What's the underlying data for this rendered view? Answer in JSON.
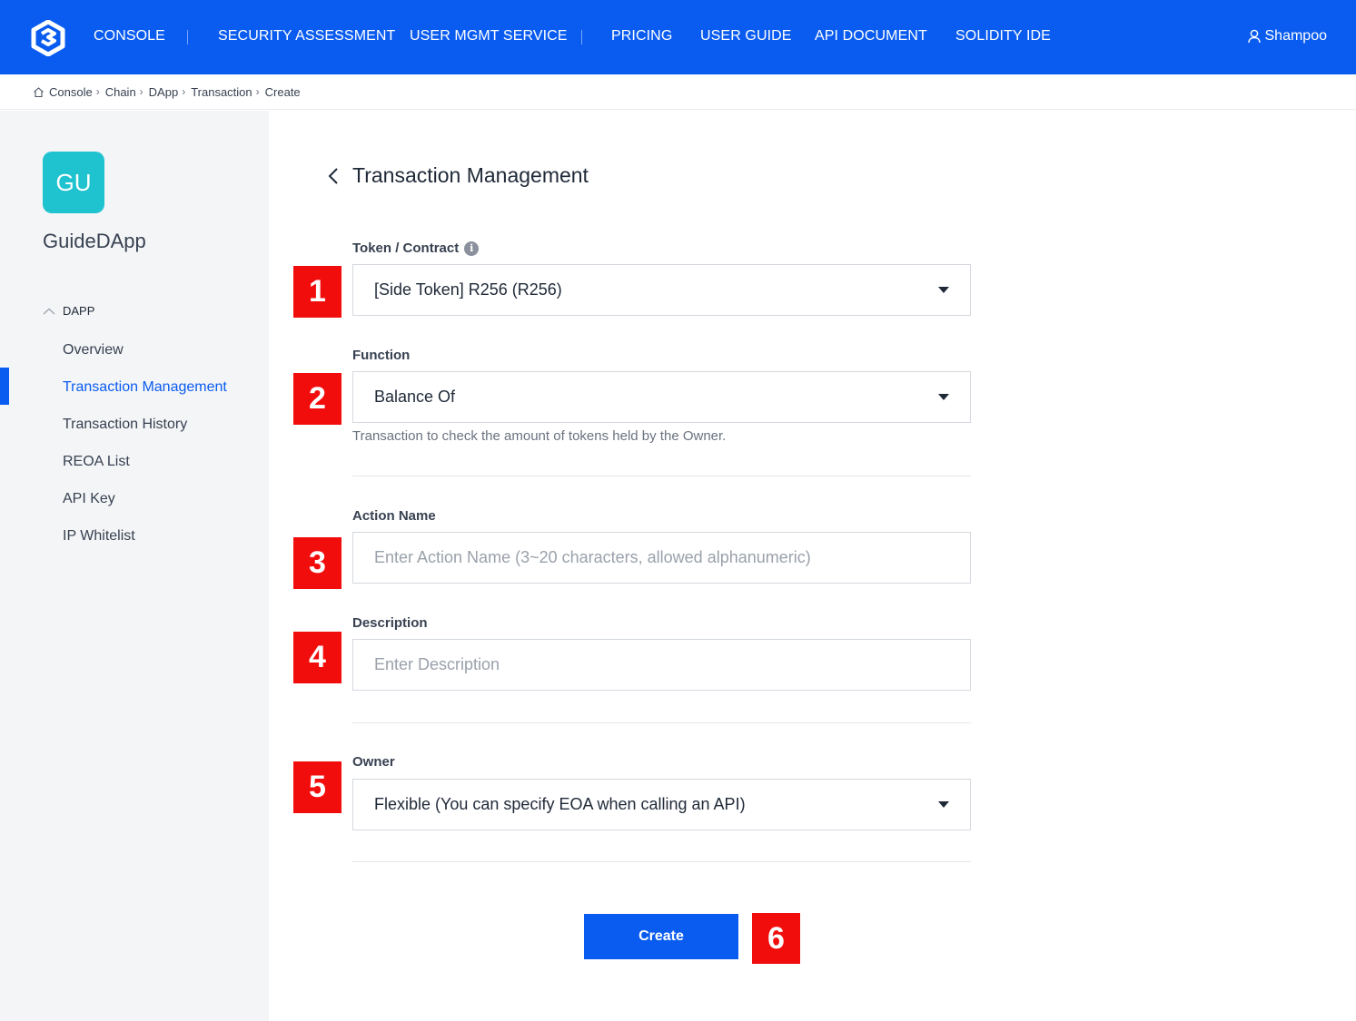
{
  "header": {
    "nav": [
      "CONSOLE",
      "SECURITY ASSESSMENT",
      "USER MGMT SERVICE",
      "PRICING",
      "USER GUIDE",
      "API DOCUMENT",
      "SOLIDITY IDE"
    ],
    "user_name": "Shampoo",
    "brand_color": "#0a5cf0"
  },
  "breadcrumb": [
    "Console",
    "Chain",
    "DApp",
    "Transaction",
    "Create"
  ],
  "sidebar": {
    "avatar_initials": "GU",
    "app_name": "GuideDApp",
    "group_label": "DAPP",
    "items": [
      {
        "label": "Overview",
        "active": false
      },
      {
        "label": "Transaction Management",
        "active": true
      },
      {
        "label": "Transaction History",
        "active": false
      },
      {
        "label": "REOA List",
        "active": false
      },
      {
        "label": "API Key",
        "active": false
      },
      {
        "label": "IP Whitelist",
        "active": false
      }
    ]
  },
  "main": {
    "title": "Transaction Management",
    "token": {
      "label": "Token / Contract",
      "value": "[Side Token] R256 (R256)"
    },
    "function": {
      "label": "Function",
      "value": "Balance Of",
      "help": "Transaction to check the amount of tokens held by the Owner."
    },
    "action_name": {
      "label": "Action Name",
      "placeholder": "Enter Action Name (3~20 characters, allowed alphanumeric)"
    },
    "description": {
      "label": "Description",
      "placeholder": "Enter Description"
    },
    "owner": {
      "label": "Owner",
      "value": "Flexible (You can specify EOA when calling an API)"
    },
    "create_label": "Create"
  },
  "markers": [
    "1",
    "2",
    "3",
    "4",
    "5",
    "6"
  ]
}
